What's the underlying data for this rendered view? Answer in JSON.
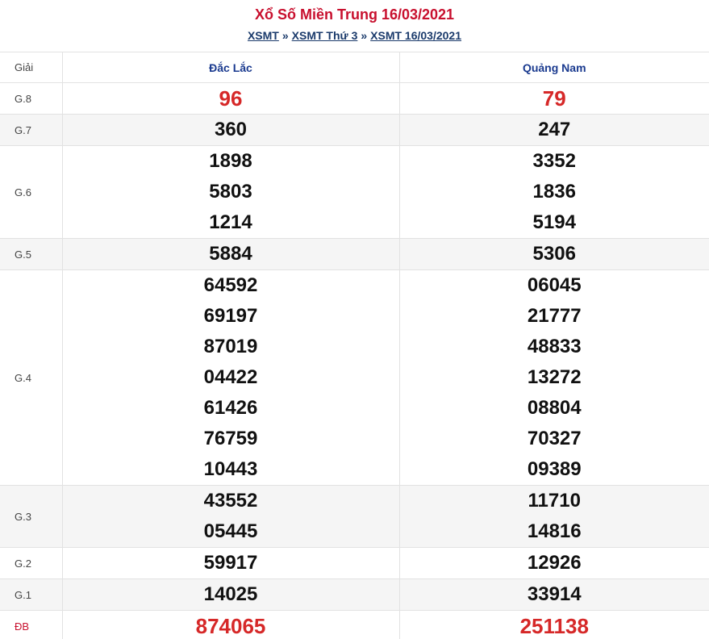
{
  "title": "Xổ Số Miền Trung 16/03/2021",
  "breadcrumb": {
    "items": [
      "XSMT",
      "XSMT Thứ 3",
      "XSMT 16/03/2021"
    ],
    "separator": "»"
  },
  "table": {
    "label_header": "Giải",
    "provinces": [
      "Đắc Lắc",
      "Quảng Nam"
    ],
    "prizes": [
      {
        "label": "G.8",
        "special": true,
        "values": [
          [
            "96"
          ],
          [
            "79"
          ]
        ]
      },
      {
        "label": "G.7",
        "values": [
          [
            "360"
          ],
          [
            "247"
          ]
        ]
      },
      {
        "label": "G.6",
        "values": [
          [
            "1898",
            "5803",
            "1214"
          ],
          [
            "3352",
            "1836",
            "5194"
          ]
        ]
      },
      {
        "label": "G.5",
        "values": [
          [
            "5884"
          ],
          [
            "5306"
          ]
        ]
      },
      {
        "label": "G.4",
        "values": [
          [
            "64592",
            "69197",
            "87019",
            "04422",
            "61426",
            "76759",
            "10443"
          ],
          [
            "06045",
            "21777",
            "48833",
            "13272",
            "08804",
            "70327",
            "09389"
          ]
        ]
      },
      {
        "label": "G.3",
        "values": [
          [
            "43552",
            "05445"
          ],
          [
            "11710",
            "14816"
          ]
        ]
      },
      {
        "label": "G.2",
        "values": [
          [
            "59917"
          ],
          [
            "12926"
          ]
        ]
      },
      {
        "label": "G.1",
        "values": [
          [
            "14025"
          ],
          [
            "33914"
          ]
        ]
      },
      {
        "label": "ĐB",
        "special": true,
        "values": [
          [
            "874065"
          ],
          [
            "251138"
          ]
        ]
      }
    ]
  },
  "colors": {
    "title": "#c8102e",
    "link": "#1a3a6b",
    "province_header": "#1a3a8f",
    "special_number": "#d62828",
    "row_shade": "#f5f5f5"
  }
}
